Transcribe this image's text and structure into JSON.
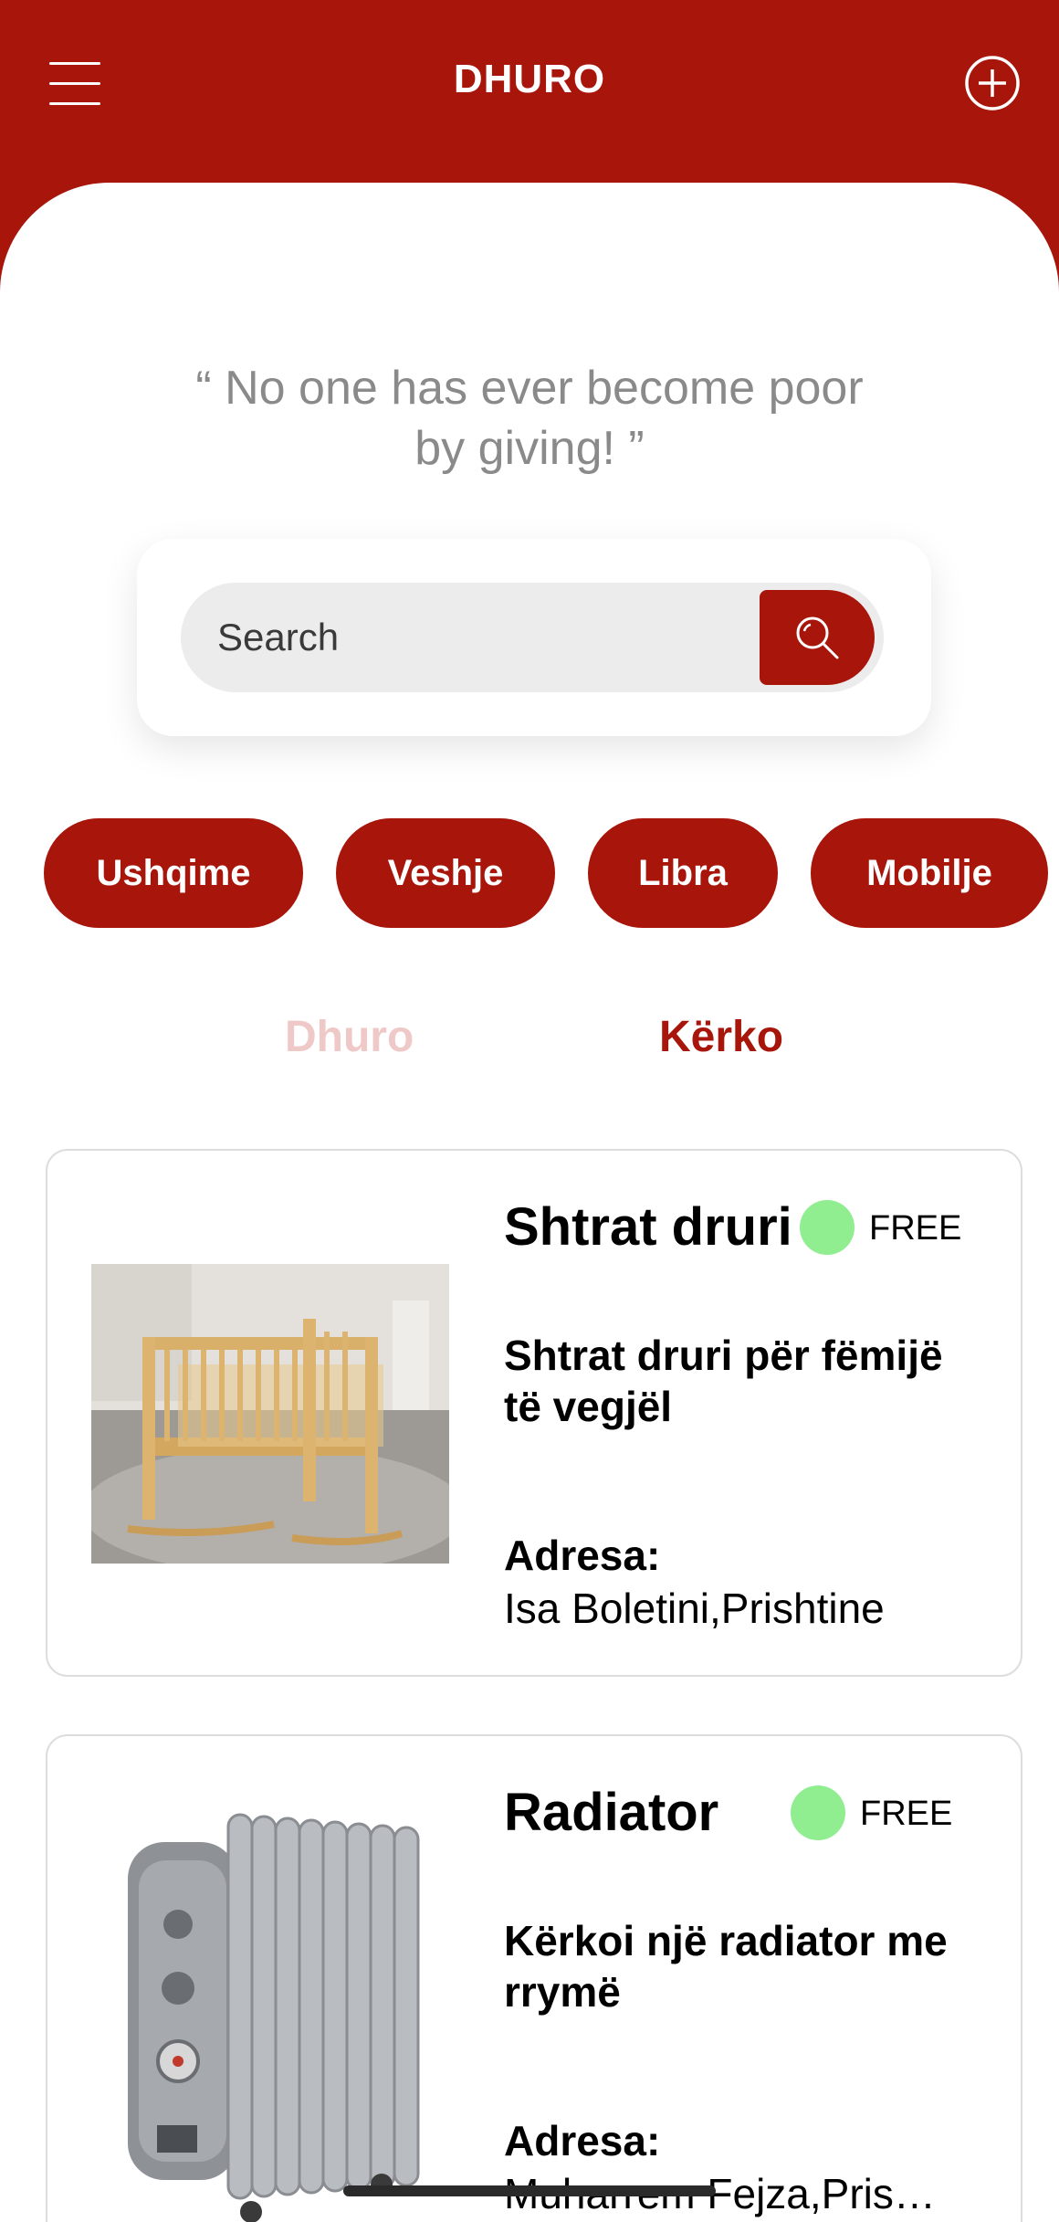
{
  "header": {
    "title": "DHURO"
  },
  "quote": "“ No one has ever become poor by giving! ”",
  "search": {
    "placeholder": "Search"
  },
  "categories": [
    {
      "label": "Ushqime"
    },
    {
      "label": "Veshje"
    },
    {
      "label": "Libra"
    },
    {
      "label": "Mobilje"
    }
  ],
  "tabs": [
    {
      "label": "Dhuro",
      "active": false
    },
    {
      "label": "Kërko",
      "active": true
    }
  ],
  "listings": [
    {
      "title": "Shtrat druri",
      "status": "FREE",
      "description": "Shtrat druri për fëmijë të vegjël",
      "address_label": "Adresa:",
      "address": "Isa Boletini,Prishtine"
    },
    {
      "title": "Radiator",
      "status": "FREE",
      "description": "Kërkoi një radiator me rrymë",
      "address_label": "Adresa:",
      "address": "Muharrem Fejza,Prishtine"
    }
  ],
  "colors": {
    "brand": "#a8150a",
    "free_dot": "#90ee90",
    "tab_inactive": "#efc9c7"
  }
}
